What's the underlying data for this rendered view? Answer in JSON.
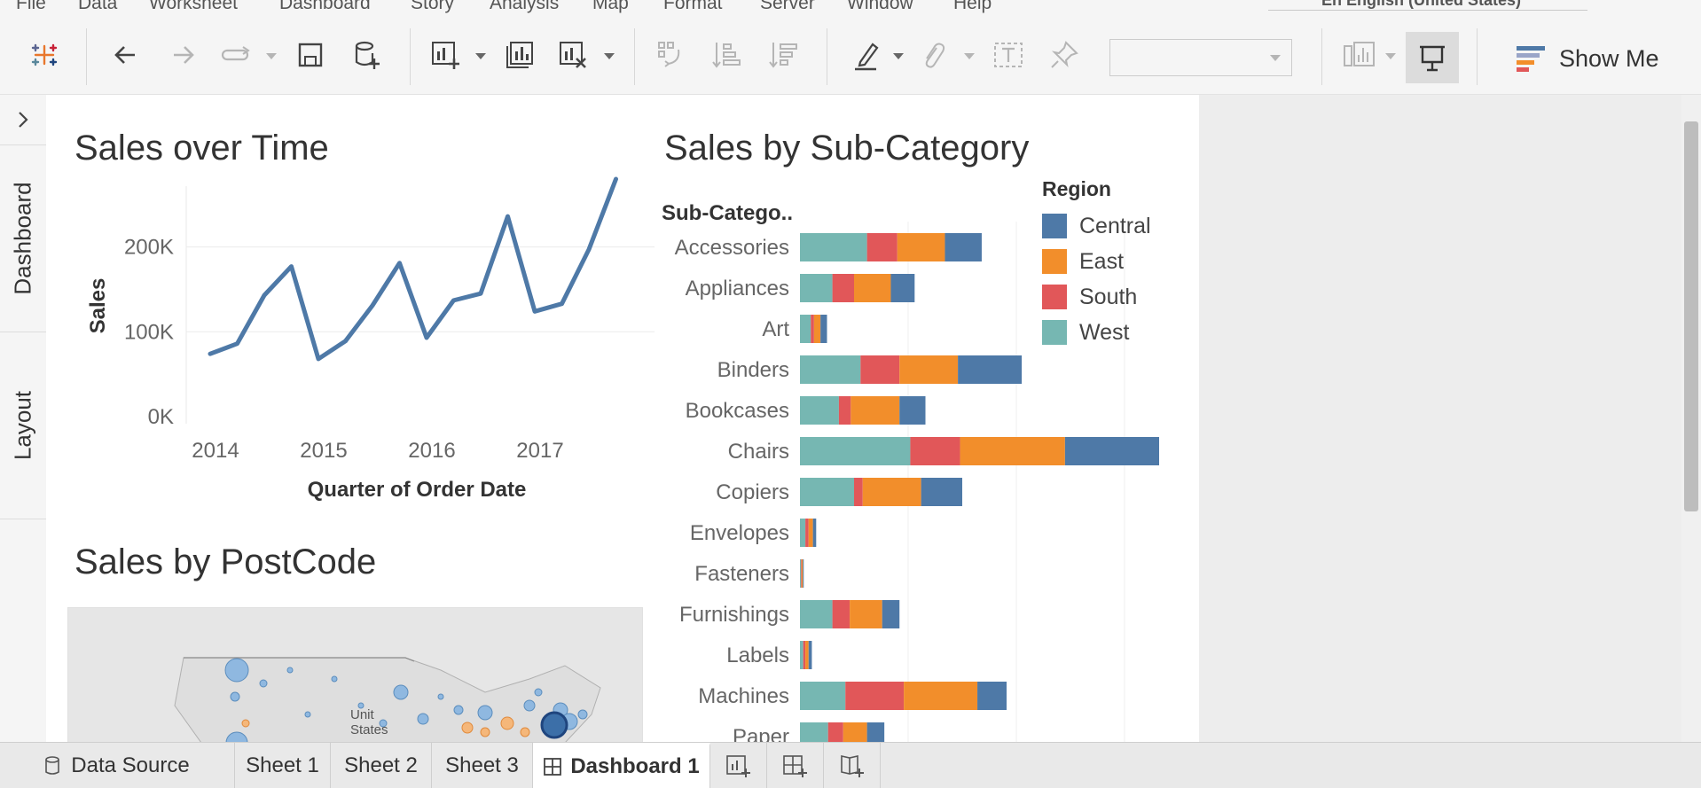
{
  "menu": [
    "File",
    "Data",
    "Worksheet",
    "Dashboard",
    "Story",
    "Analysis",
    "Map",
    "Format",
    "Server",
    "Window",
    "Help"
  ],
  "language": "En English (United States)",
  "toolbar": {
    "show_me_label": "Show Me",
    "colors": {
      "active_bg": "#dcdcdc"
    }
  },
  "side_panel": {
    "tabs": [
      "Dashboard",
      "Layout"
    ]
  },
  "sheets": {
    "line": {
      "title": "Sales over Time"
    },
    "bar": {
      "title": "Sales by Sub-Category"
    },
    "map": {
      "title": "Sales by PostCode",
      "labels": [
        "Unit",
        "States"
      ]
    }
  },
  "chart_data": [
    {
      "type": "line",
      "title": "Sales over Time",
      "xlabel": "Quarter of Order Date",
      "ylabel": "Sales",
      "x_ticks": [
        "2014",
        "2015",
        "2016",
        "2017"
      ],
      "y_ticks": [
        "0K",
        "100K",
        "200K"
      ],
      "ylim": [
        0,
        280000
      ],
      "x": [
        "2014 Q1",
        "2014 Q2",
        "2014 Q3",
        "2014 Q4",
        "2015 Q1",
        "2015 Q2",
        "2015 Q3",
        "2015 Q4",
        "2016 Q1",
        "2016 Q2",
        "2016 Q3",
        "2016 Q4",
        "2017 Q1",
        "2017 Q2",
        "2017 Q3",
        "2017 Q4"
      ],
      "values": [
        74000,
        86000,
        143000,
        177000,
        68000,
        89000,
        131000,
        181000,
        93000,
        137000,
        145000,
        236000,
        124000,
        133000,
        197000,
        280000
      ],
      "color": "#4e79a7"
    },
    {
      "type": "bar",
      "title": "Sales by Sub-Category",
      "xlabel": "",
      "ylabel": "Sub-Catego..",
      "orientation": "horizontal",
      "stacked": true,
      "legend_title": "Region",
      "legend_placement": "top-right",
      "categories": [
        "Accessories",
        "Appliances",
        "Art",
        "Binders",
        "Bookcases",
        "Chairs",
        "Copiers",
        "Envelopes",
        "Fasteners",
        "Furnishings",
        "Labels",
        "Machines",
        "Paper"
      ],
      "series": [
        {
          "name": "West",
          "color": "#76b7b2",
          "values": [
            62000,
            30000,
            10000,
            56000,
            36000,
            102000,
            50000,
            5000,
            1000,
            30000,
            3000,
            42000,
            26000
          ]
        },
        {
          "name": "South",
          "color": "#e15759",
          "values": [
            28000,
            20000,
            3000,
            36000,
            11000,
            46000,
            8000,
            3000,
            600,
            16000,
            2000,
            54000,
            14000
          ]
        },
        {
          "name": "East",
          "color": "#f28e2b",
          "values": [
            44000,
            34000,
            6000,
            54000,
            45000,
            97000,
            54000,
            4000,
            1100,
            30000,
            3000,
            68000,
            22000
          ]
        },
        {
          "name": "Central",
          "color": "#4e79a7",
          "values": [
            34000,
            22000,
            6000,
            59000,
            24000,
            87000,
            38000,
            3000,
            800,
            16000,
            3000,
            27000,
            16000
          ]
        }
      ],
      "legend": [
        "Central",
        "East",
        "South",
        "West"
      ]
    }
  ],
  "tabs": [
    {
      "label": "Data Source"
    },
    {
      "label": "Sheet 1"
    },
    {
      "label": "Sheet 2"
    },
    {
      "label": "Sheet 3"
    },
    {
      "label": "Dashboard 1",
      "active": true
    }
  ]
}
